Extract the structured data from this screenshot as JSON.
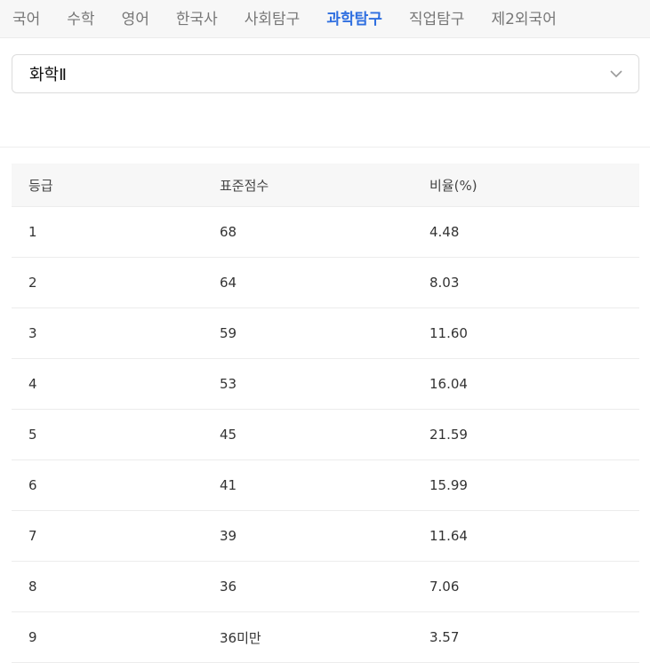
{
  "tabs": [
    {
      "label": "국어",
      "active": false
    },
    {
      "label": "수학",
      "active": false
    },
    {
      "label": "영어",
      "active": false
    },
    {
      "label": "한국사",
      "active": false
    },
    {
      "label": "사회탐구",
      "active": false
    },
    {
      "label": "과학탐구",
      "active": true
    },
    {
      "label": "직업탐구",
      "active": false
    },
    {
      "label": "제2외국어",
      "active": false
    }
  ],
  "subject_select": {
    "value": "화학Ⅱ",
    "icon": "chevron-down-icon"
  },
  "table": {
    "headers": [
      "등급",
      "표준점수",
      "비율(%)"
    ],
    "rows": [
      [
        "1",
        "68",
        "4.48"
      ],
      [
        "2",
        "64",
        "8.03"
      ],
      [
        "3",
        "59",
        "11.60"
      ],
      [
        "4",
        "53",
        "16.04"
      ],
      [
        "5",
        "45",
        "21.59"
      ],
      [
        "6",
        "41",
        "15.99"
      ],
      [
        "7",
        "39",
        "11.64"
      ],
      [
        "8",
        "36",
        "7.06"
      ],
      [
        "9",
        "36미만",
        "3.57"
      ]
    ]
  },
  "colors": {
    "accent": "#2f6fe0",
    "tabbar_bg": "#f7f7f7",
    "header_bg": "#f7f7f7"
  }
}
